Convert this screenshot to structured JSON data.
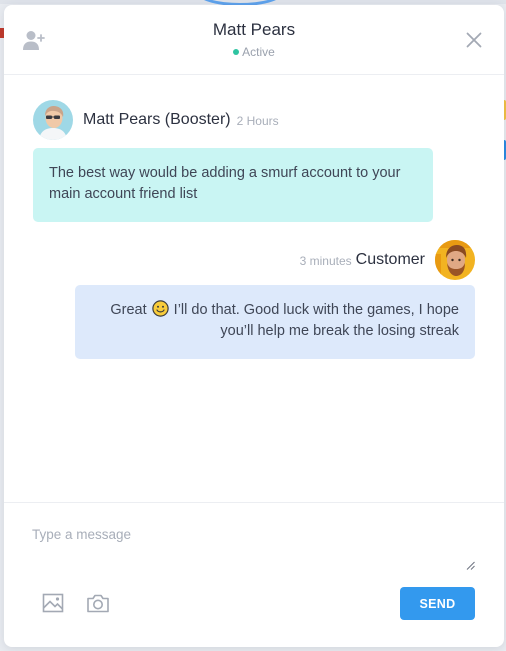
{
  "header": {
    "contact_name": "Matt Pears",
    "status": "Active",
    "status_color": "#2ec4a1"
  },
  "messages": [
    {
      "sender": "Matt Pears (Booster)",
      "time": "2 Hours",
      "text": "The best way would be adding a smurf account to your main account friend list",
      "direction": "incoming",
      "bubble_color": "#c9f5f3"
    },
    {
      "sender": "Customer",
      "time": "3 minutes",
      "text_before_emoji": "Great",
      "emoji": "smiley-icon",
      "text_after_emoji": "I’ll do that. Good luck with the games, I hope you’ll help me break the losing streak",
      "direction": "outgoing",
      "bubble_color": "#dde9fb"
    }
  ],
  "composer": {
    "placeholder": "Type a message",
    "value": "",
    "send_label": "SEND",
    "send_color": "#3399ee"
  },
  "icons": {
    "add_user": "add-user-icon",
    "close": "close-icon",
    "image": "image-icon",
    "camera": "camera-icon"
  }
}
